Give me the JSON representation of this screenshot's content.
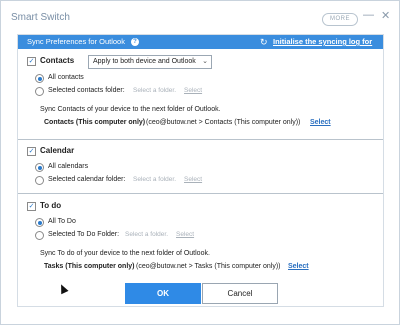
{
  "window": {
    "title": "Smart Switch",
    "more_label": "MORE",
    "minimize": "—",
    "close": "✕"
  },
  "header": {
    "title": "Sync Preferences for Outlook",
    "help": "?",
    "sync_icon": "↻",
    "init_link": "Initialise the syncing log for Outlook"
  },
  "contacts": {
    "label": "Contacts",
    "dropdown": "Apply to both device and Outlook",
    "option_all": "All contacts",
    "option_selected": "Selected contacts folder:",
    "folder_placeholder": "Select a folder.",
    "select_link": "Select",
    "sync_text": "Sync Contacts of your device to the next folder of Outlook.",
    "folder_name": "Contacts (This computer only)",
    "folder_path": "(ceo@butow.net > Contacts (This computer only))",
    "folder_select": "Select"
  },
  "calendar": {
    "label": "Calendar",
    "option_all": "All calendars",
    "option_selected": "Selected calendar folder:",
    "folder_placeholder": "Select a folder.",
    "select_link": "Select"
  },
  "todo": {
    "label": "To do",
    "option_all": "All To Do",
    "option_selected": "Selected To Do Folder:",
    "folder_placeholder": "Select a folder.",
    "select_link": "Select",
    "sync_text": "Sync To do of your device to the next folder of Outlook.",
    "folder_name": "Tasks (This computer only)",
    "folder_path": "(ceo@butow.net > Tasks (This computer only))",
    "folder_select": "Select"
  },
  "buttons": {
    "ok": "OK",
    "cancel": "Cancel"
  }
}
